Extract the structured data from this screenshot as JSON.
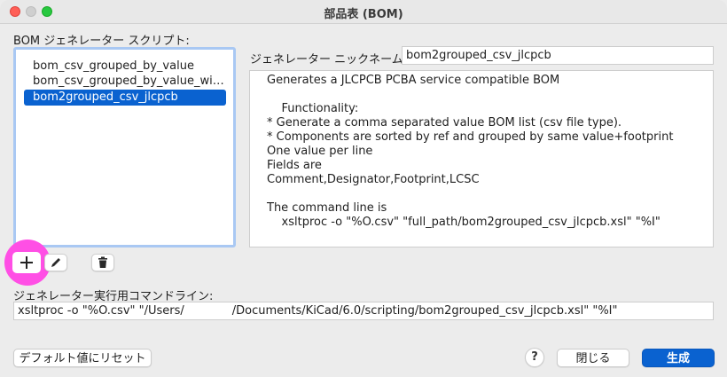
{
  "window": {
    "title": "部品表 (BOM)"
  },
  "scripts_section": {
    "label": "BOM ジェネレーター スクリプト:",
    "items": [
      {
        "label": "bom_csv_grouped_by_value"
      },
      {
        "label": "bom_csv_grouped_by_value_wit..."
      },
      {
        "label": "bom2grouped_csv_jlcpcb"
      }
    ],
    "selected_index": 2
  },
  "toolbar": {
    "add_icon": "plus-icon",
    "edit_icon": "pencil-icon",
    "delete_icon": "trash-icon"
  },
  "nickname": {
    "label": "ジェネレーター ニックネーム:",
    "value": "bom2grouped_csv_jlcpcb"
  },
  "description": {
    "lines": [
      "Generates a JLCPCB PCBA service compatible BOM",
      "",
      "    Functionality:",
      "* Generate a comma separated value BOM list (csv file type).",
      "* Components are sorted by ref and grouped by same value+footprint",
      "One value per line",
      "Fields are",
      "Comment,Designator,Footprint,LCSC",
      "",
      "The command line is",
      "    xsltproc -o \"%O.csv\" \"full_path/bom2grouped_csv_jlcpcb.xsl\" \"%I\""
    ]
  },
  "command": {
    "label": "ジェネレーター実行用コマンドライン:",
    "value_prefix": "xsltproc -o \"%O.csv\" \"/Users/",
    "value_suffix": "/Documents/KiCad/6.0/scripting/bom2grouped_csv_jlcpcb.xsl\" \"%I\""
  },
  "footer": {
    "reset_label": "デフォルト値にリセット",
    "help_label": "?",
    "close_label": "閉じる",
    "generate_label": "生成"
  },
  "colors": {
    "accent": "#0a62d0",
    "highlight": "#ff4fe5"
  }
}
